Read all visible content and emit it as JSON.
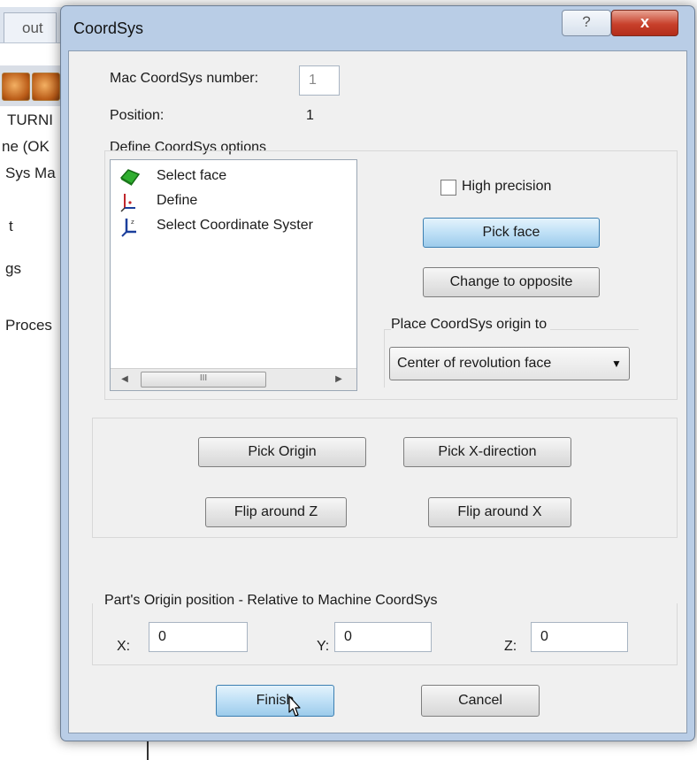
{
  "background_app": {
    "tab_label": "out",
    "tree_items": [
      "TURNI",
      "ne (OK",
      "Sys Ma",
      "t",
      "gs",
      "Proces"
    ]
  },
  "dialog": {
    "title": "CoordSys",
    "help_label": "?",
    "close_label": "x",
    "mac_coordsys_label": "Mac CoordSys number:",
    "mac_coordsys_value": "1",
    "position_label": "Position:",
    "position_value": "1",
    "define_options_label": "Define CoordSys options",
    "options": [
      {
        "label": "Select face",
        "icon": "green-face-icon"
      },
      {
        "label": "Define",
        "icon": "axis-define-icon"
      },
      {
        "label": "Select Coordinate Syster",
        "icon": "coordinate-system-icon"
      }
    ],
    "scroll_thumb_grip": "III",
    "high_precision_label": "High precision",
    "high_precision_checked": false,
    "pick_face_label": "Pick face",
    "change_opposite_label": "Change to opposite",
    "place_origin_label": "Place CoordSys origin to",
    "place_origin_value": "Center of revolution face",
    "pick_origin_label": "Pick Origin",
    "pick_x_direction_label": "Pick X-direction",
    "flip_z_label": "Flip around Z",
    "flip_x_label": "Flip around X",
    "parts_origin_label": "Part's Origin position - Relative to Machine CoordSys",
    "x_label": "X:",
    "x_value": "0",
    "y_label": "Y:",
    "y_value": "0",
    "z_label": "Z:",
    "z_value": "0",
    "finish_label": "Finish",
    "cancel_label": "Cancel"
  },
  "colors": {
    "primary_button": "#bfe0f6",
    "close_button": "#c8402b",
    "dialog_frame": "#b9cde6"
  }
}
